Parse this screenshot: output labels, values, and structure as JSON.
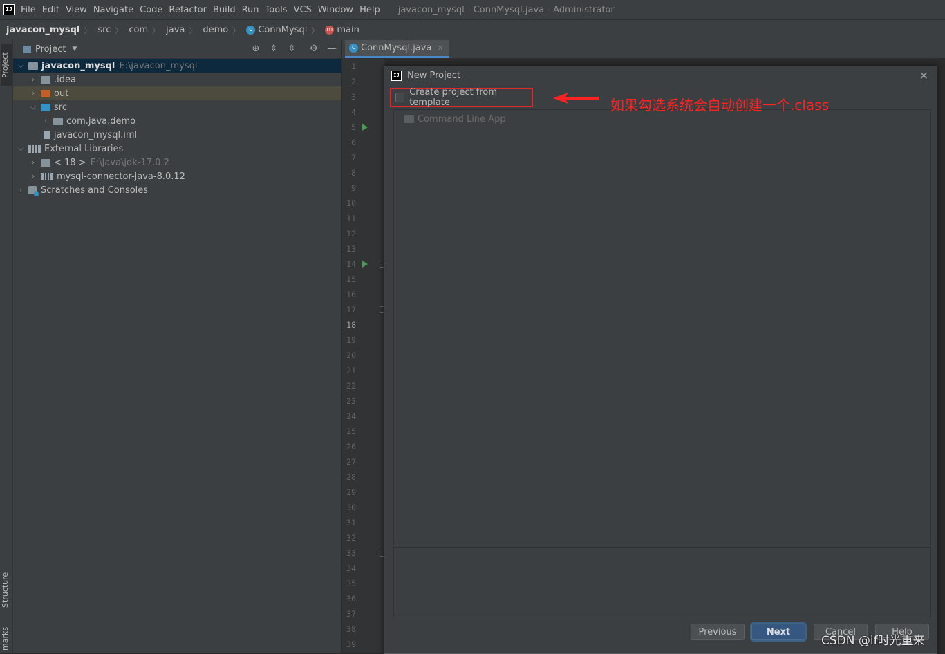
{
  "menubar": {
    "items": [
      "File",
      "Edit",
      "View",
      "Navigate",
      "Code",
      "Refactor",
      "Build",
      "Run",
      "Tools",
      "VCS",
      "Window",
      "Help"
    ],
    "window_title": "javacon_mysql - ConnMysql.java - Administrator"
  },
  "breadcrumb": {
    "project": "javacon_mysql",
    "parts": [
      "src",
      "com",
      "java",
      "demo"
    ],
    "class_name": "ConnMysql",
    "method": "main"
  },
  "left_strip": {
    "tab_project": "Project",
    "tab_structure": "Structure",
    "tab_bookmarks": "marks"
  },
  "project_panel": {
    "title": "Project",
    "tree": [
      {
        "label": "javacon_mysql",
        "path": "E:\\javacon_mysql"
      },
      {
        "label": ".idea"
      },
      {
        "label": "out"
      },
      {
        "label": "src"
      },
      {
        "label": "com.java.demo"
      },
      {
        "label": "javacon_mysql.iml"
      },
      {
        "label": "External Libraries"
      },
      {
        "label": "< 18 >",
        "path": "E:\\Java\\jdk-17.0.2"
      },
      {
        "label": "mysql-connector-java-8.0.12"
      },
      {
        "label": "Scratches and Consoles"
      }
    ]
  },
  "editor": {
    "tab_label": "ConnMysql.java",
    "current_line": "18",
    "line_numbers": [
      "1",
      "2",
      "3",
      "4",
      "5",
      "6",
      "7",
      "8",
      "9",
      "10",
      "11",
      "12",
      "13",
      "14",
      "15",
      "16",
      "17",
      "18",
      "19",
      "20",
      "21",
      "22",
      "23",
      "24",
      "25",
      "26",
      "27",
      "28",
      "29",
      "30",
      "31",
      "32",
      "33",
      "34",
      "35",
      "36",
      "37",
      "38",
      "39"
    ]
  },
  "dialog": {
    "title": "New Project",
    "template_checkbox_label": "Create project from template",
    "template_checked": false,
    "template_item": "Command Line App",
    "buttons": {
      "previous": "Previous",
      "next": "Next",
      "cancel": "Cancel",
      "help": "Help"
    }
  },
  "annotation": {
    "text": "如果勾选系统会自动创建一个.class",
    "color": "#ff2222"
  },
  "watermark": "CSDN @if时光重来",
  "colors": {
    "accent": "#4a88c7",
    "selection": "#0d293e",
    "highlight_box": "#e02a2a",
    "run_green": "#499c54"
  }
}
